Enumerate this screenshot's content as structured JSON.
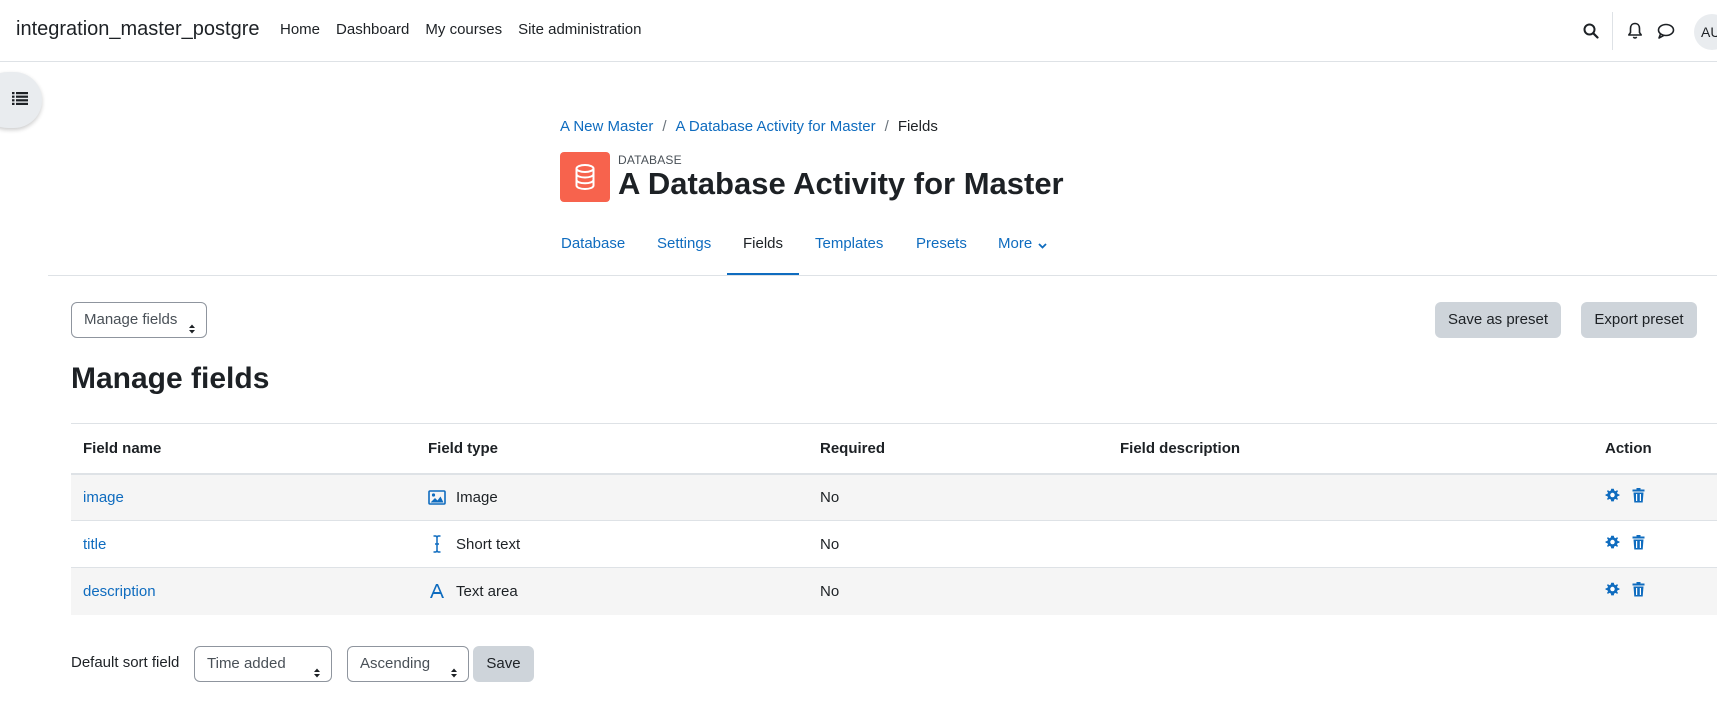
{
  "navbar": {
    "site_name": "integration_master_postgre",
    "links": [
      "Home",
      "Dashboard",
      "My courses",
      "Site administration"
    ],
    "avatar_initials": "AU"
  },
  "breadcrumb": {
    "items": [
      "A New Master",
      "A Database Activity for Master"
    ],
    "current": "Fields"
  },
  "header": {
    "activity_kind": "DATABASE",
    "title": "A Database Activity for Master",
    "icon_color": "#f7634d"
  },
  "secondary_nav": {
    "tabs": [
      "Database",
      "Settings",
      "Fields",
      "Templates",
      "Presets",
      "More"
    ],
    "active": "Fields"
  },
  "toolbar": {
    "manage_select": "Manage fields",
    "save_preset": "Save as preset",
    "export_preset": "Export preset"
  },
  "section_title": "Manage fields",
  "table": {
    "headers": [
      "Field name",
      "Field type",
      "Required",
      "Field description",
      "Action"
    ],
    "rows": [
      {
        "name": "image",
        "type": "Image",
        "type_icon": "image-icon",
        "required": "No",
        "description": ""
      },
      {
        "name": "title",
        "type": "Short text",
        "type_icon": "text-cursor-icon",
        "required": "No",
        "description": ""
      },
      {
        "name": "description",
        "type": "Text area",
        "type_icon": "font-a-icon",
        "required": "No",
        "description": ""
      }
    ]
  },
  "sort": {
    "label": "Default sort field",
    "field_value": "Time added",
    "order_value": "Ascending",
    "save_label": "Save"
  },
  "colors": {
    "link": "#0f6cbf",
    "secondary_button": "#ced4da"
  }
}
